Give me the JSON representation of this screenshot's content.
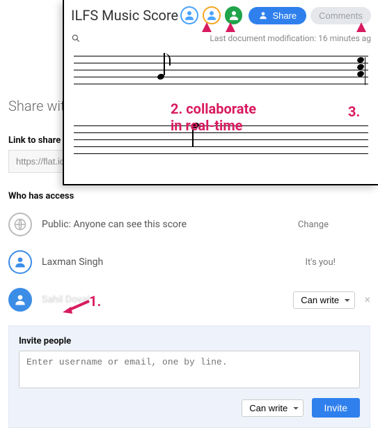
{
  "editor": {
    "title": "ILFS Music Score",
    "share_button": "Share",
    "comments_button": "Comments",
    "status": "Last document modification: 16 minutes ag"
  },
  "share": {
    "header": "Share with",
    "link_label": "Link to share",
    "link_value": "https://flat.ic",
    "access_label": "Who has access",
    "public_text": "Public: Anyone can see this score",
    "change_label": "Change",
    "user1_name": "Laxman Singh",
    "user1_right": "It's you!",
    "user2_name": "Sahil Doval",
    "perm_canwrite": "Can write",
    "invite_label": "Invite people",
    "invite_placeholder": "Enter username or email, one by line.",
    "invite_button": "Invite"
  },
  "annotations": {
    "a1": "1.",
    "a2": "2. collaborate\nin real-time",
    "a3": "3."
  }
}
